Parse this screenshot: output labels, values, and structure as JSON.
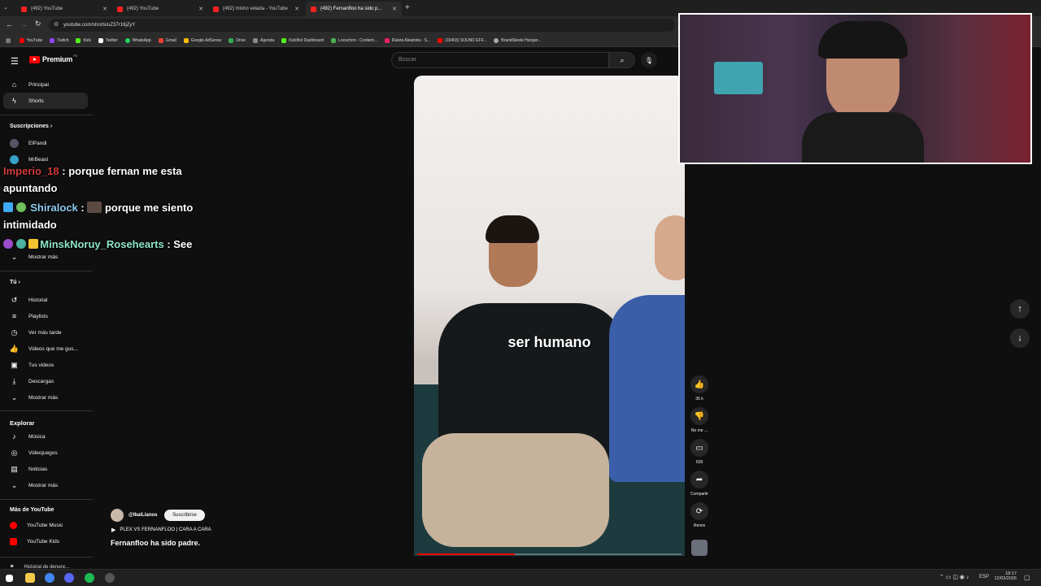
{
  "browser": {
    "tabs": [
      {
        "title": "(492) YouTube",
        "active": false
      },
      {
        "title": "(492) YouTube",
        "active": false
      },
      {
        "title": "(492) misho velada - YouTube",
        "active": false
      },
      {
        "title": "(492) Fernanfloo ha sido p...",
        "active": true
      }
    ],
    "new_tab": "+",
    "url": "youtube.com/shorts/uZ37r16jZyY",
    "bookmarks": [
      "YouTube",
      "Twitch",
      "Kick",
      "Twitter",
      "WhatsApp",
      "Gmail",
      "Google AdSense",
      "Drive",
      "Agenda",
      "KickBot Dashboard",
      "Locochon - Content...",
      "Ruleta Aleatoria - S...",
      "(10403) SOUND EFF...",
      "BrandSteele Hunger..."
    ]
  },
  "youtube": {
    "logo": "Premium",
    "logo_sup": "PE",
    "search_placeholder": "Buscar",
    "sidebar": {
      "main": [
        {
          "label": "Principal",
          "icon": "home-icon"
        },
        {
          "label": "Shorts",
          "icon": "shorts-icon"
        }
      ],
      "subs_header": "Suscripciones",
      "subs": [
        "ElPandi",
        "MrBeast"
      ],
      "subs_more": "Mostrar más",
      "you_header": "Tú",
      "you": [
        {
          "label": "Historial",
          "icon": "history-icon"
        },
        {
          "label": "Playlists",
          "icon": "playlist-icon"
        },
        {
          "label": "Ver más tarde",
          "icon": "clock-icon"
        },
        {
          "label": "Videos que me gus...",
          "icon": "like-icon"
        },
        {
          "label": "Tus videos",
          "icon": "video-icon"
        },
        {
          "label": "Descargas",
          "icon": "download-icon"
        },
        {
          "label": "Mostrar más",
          "icon": "chevron-down-icon"
        }
      ],
      "explore_header": "Explorar",
      "explore": [
        {
          "label": "Música",
          "icon": "music-icon"
        },
        {
          "label": "Videojuegos",
          "icon": "gaming-icon"
        },
        {
          "label": "Noticias",
          "icon": "news-icon"
        },
        {
          "label": "Mostrar más",
          "icon": "chevron-down-icon"
        }
      ],
      "more_header": "Más de YouTube",
      "more": [
        "YouTube Music",
        "YouTube Kids"
      ],
      "bottom_cut": "Historial de denunc..."
    },
    "short": {
      "caption": "ser humano",
      "channel": "@IbaiLlanos",
      "subscribe": "Suscribirse",
      "playlist": "PLEX VS FERNANFLOO | CARA A CARA",
      "title": "Fernanfloo ha sido padre.",
      "progress_pct": 37
    },
    "actions": {
      "likes": "35 k",
      "dislike": "No me ...",
      "comments": "639",
      "share": "Compartir",
      "remix": "Remix"
    }
  },
  "chat": [
    {
      "user": "Imperio_18",
      "message": " : porque fernan me esta",
      "cont": "apuntando",
      "user_color": "#d13a3a"
    },
    {
      "user": "Shiralock",
      "message": " porque me siento",
      "cont": "intimidado",
      "user_color": "#8ecbf0"
    },
    {
      "user": "MinskNoruy_Rosehearts",
      "message": " : See",
      "cont": "",
      "user_color": "#8fe3c8"
    }
  ],
  "taskbar": {
    "lang": "ESP",
    "time": "18:17",
    "date": "12/03/2026"
  }
}
